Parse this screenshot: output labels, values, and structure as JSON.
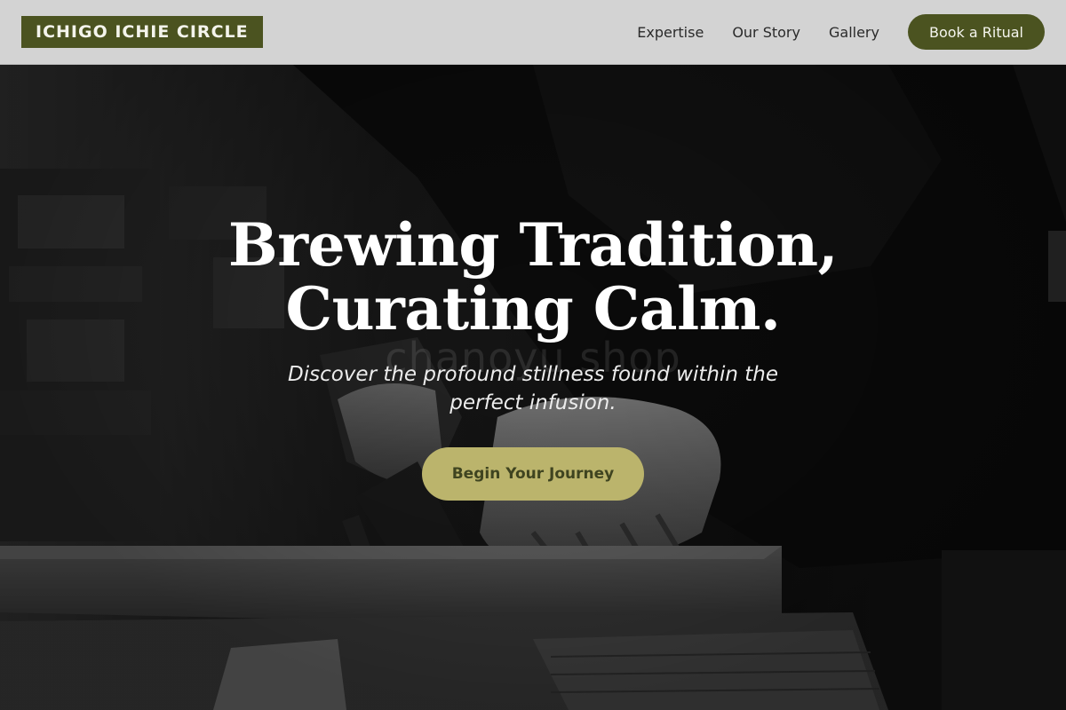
{
  "header": {
    "logo": "ICHIGO ICHIE CIRCLE",
    "nav": [
      {
        "label": "Expertise"
      },
      {
        "label": "Our Story"
      },
      {
        "label": "Gallery"
      }
    ],
    "cta_label": "Book a Ritual"
  },
  "hero": {
    "title_line1": "Brewing Tradition,",
    "title_line2": "Curating Calm.",
    "subtitle": "Discover the profound stillness found within the perfect infusion.",
    "cta_label": "Begin Your Journey",
    "watermark": "chanoyu shop"
  },
  "colors": {
    "brand_olive": "#4b5320",
    "accent_khaki": "#bbb46c",
    "header_bg": "#d3d3d3"
  }
}
